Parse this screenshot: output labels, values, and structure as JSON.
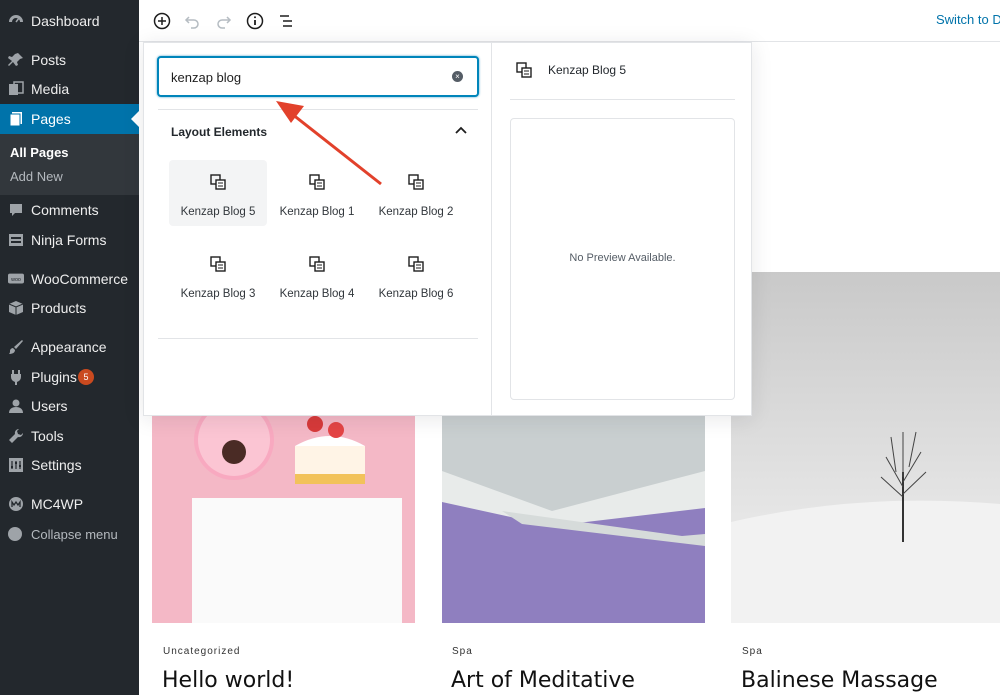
{
  "sidebar": {
    "items": [
      {
        "label": "Dashboard",
        "icon": "dashboard-icon"
      },
      {
        "label": "Posts",
        "icon": "pin-icon"
      },
      {
        "label": "Media",
        "icon": "media-icon"
      },
      {
        "label": "Pages",
        "icon": "pages-icon"
      },
      {
        "label": "Comments",
        "icon": "comment-icon"
      },
      {
        "label": "Ninja Forms",
        "icon": "forms-icon"
      },
      {
        "label": "WooCommerce",
        "icon": "woocommerce-icon"
      },
      {
        "label": "Products",
        "icon": "box-icon"
      },
      {
        "label": "Appearance",
        "icon": "brush-icon"
      },
      {
        "label": "Plugins",
        "icon": "plugin-icon",
        "badge": "5"
      },
      {
        "label": "Users",
        "icon": "user-icon"
      },
      {
        "label": "Tools",
        "icon": "wrench-icon"
      },
      {
        "label": "Settings",
        "icon": "settings-icon"
      },
      {
        "label": "MC4WP",
        "icon": "mc4wp-icon"
      }
    ],
    "submenu": {
      "all_pages": "All Pages",
      "add_new": "Add New"
    },
    "collapse": "Collapse menu"
  },
  "toolbar": {
    "switch_link": "Switch to Dr"
  },
  "inserter": {
    "search_value": "kenzap blog",
    "panel_title": "Layout Elements",
    "blocks": [
      "Kenzap Blog 5",
      "Kenzap Blog 1",
      "Kenzap Blog 2",
      "Kenzap Blog 3",
      "Kenzap Blog 4",
      "Kenzap Blog 6"
    ],
    "preview_title": "Kenzap Blog 5",
    "preview_message": "No Preview Available."
  },
  "posts": [
    {
      "category": "Uncategorized",
      "title": "Hello world!"
    },
    {
      "category": "Spa",
      "title": "Art of Meditative"
    },
    {
      "category": "Spa",
      "title": "Balinese Massage"
    }
  ],
  "colors": {
    "sidebar_bg": "#23282d",
    "active_menu": "#0073aa",
    "focus_border": "#0085ba",
    "annotation_arrow": "#e2412b",
    "badge": "#ca4a1f"
  }
}
